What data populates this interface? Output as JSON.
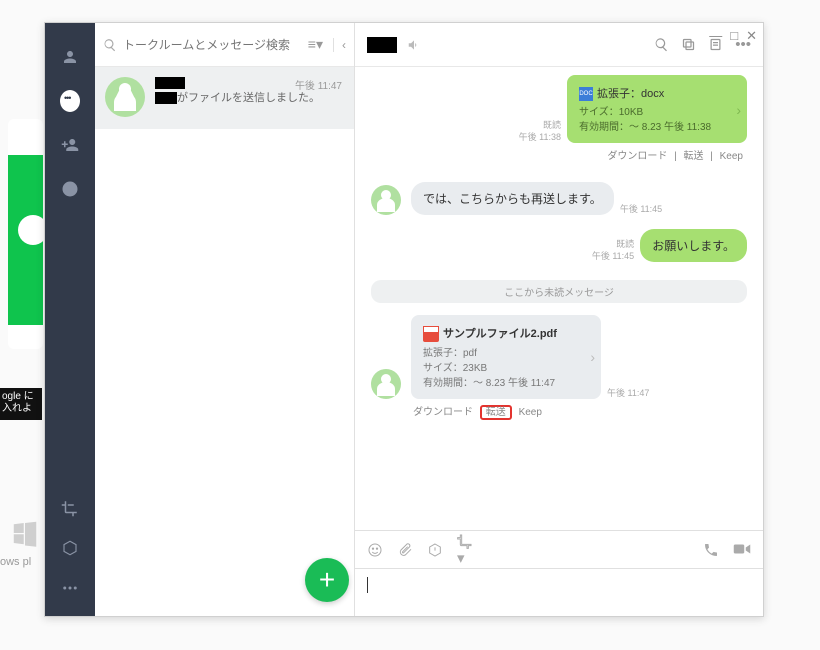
{
  "search": {
    "placeholder": "トークルームとメッセージ検索"
  },
  "room": {
    "summary": "がファイルを送信しました。",
    "time": "午後 11:47"
  },
  "bg": {
    "google": "ogle\nに入れよ",
    "wintxt": "ows pl"
  },
  "chat": {
    "file1": {
      "ext": "拡張子：docx",
      "size": "サイズ：10KB",
      "expiry": "有効期間：～ 8.23 午後 11:38",
      "read": "既読",
      "time": "午後 11:38"
    },
    "actions": {
      "download": "ダウンロード",
      "forward": "転送",
      "keep": "Keep"
    },
    "msg1": {
      "text": "では、こちらからも再送します。",
      "time": "午後 11:45"
    },
    "msg2": {
      "text": "お願いします。",
      "read": "既読",
      "time": "午後 11:45"
    },
    "divider": "ここから未読メッセージ",
    "file2": {
      "name": "サンプルファイル2.pdf",
      "ext": "拡張子：pdf",
      "size": "サイズ：23KB",
      "expiry": "有効期間：～ 8.23 午後 11:47",
      "time": "午後 11:47"
    }
  }
}
